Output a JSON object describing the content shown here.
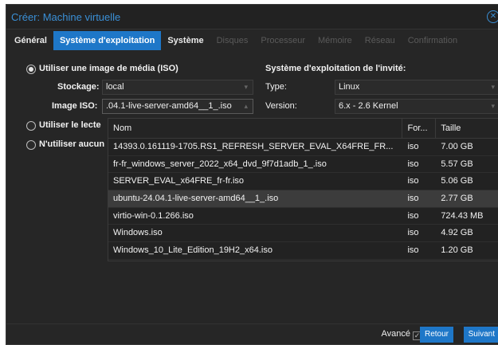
{
  "window": {
    "title": "Créer: Machine virtuelle",
    "close_icon": "close-icon"
  },
  "tabs": [
    {
      "label": "Général",
      "state": "normal"
    },
    {
      "label": "Système d'exploitation",
      "state": "active"
    },
    {
      "label": "Système",
      "state": "normal"
    },
    {
      "label": "Disques",
      "state": "disabled"
    },
    {
      "label": "Processeur",
      "state": "disabled"
    },
    {
      "label": "Mémoire",
      "state": "disabled"
    },
    {
      "label": "Réseau",
      "state": "disabled"
    },
    {
      "label": "Confirmation",
      "state": "disabled"
    }
  ],
  "media": {
    "use_iso_label": "Utiliser une image de média (ISO)",
    "storage_label": "Stockage:",
    "storage_value": "local",
    "iso_label": "Image ISO:",
    "iso_value": ".04.1-live-server-amd64__1_.iso",
    "use_drive_label": "Utiliser le lecte",
    "no_media_label": "N'utiliser aucun"
  },
  "guest_os": {
    "heading": "Système d'exploitation de l'invité:",
    "type_label": "Type:",
    "type_value": "Linux",
    "version_label": "Version:",
    "version_value": "6.x - 2.6 Kernel"
  },
  "iso_list": {
    "columns": {
      "name": "Nom",
      "format": "For...",
      "size": "Taille"
    },
    "rows": [
      {
        "name": "14393.0.161119-1705.RS1_REFRESH_SERVER_EVAL_X64FRE_FR...",
        "format": "iso",
        "size": "7.00 GB"
      },
      {
        "name": "fr-fr_windows_server_2022_x64_dvd_9f7d1adb_1_.iso",
        "format": "iso",
        "size": "5.57 GB"
      },
      {
        "name": "SERVER_EVAL_x64FRE_fr-fr.iso",
        "format": "iso",
        "size": "5.06 GB"
      },
      {
        "name": "ubuntu-24.04.1-live-server-amd64__1_.iso",
        "format": "iso",
        "size": "2.77 GB"
      },
      {
        "name": "virtio-win-0.1.266.iso",
        "format": "iso",
        "size": "724.43 MB"
      },
      {
        "name": "Windows.iso",
        "format": "iso",
        "size": "4.92 GB"
      },
      {
        "name": "Windows_10_Lite_Edition_19H2_x64.iso",
        "format": "iso",
        "size": "1.20 GB"
      }
    ],
    "selected_index": 3
  },
  "footer": {
    "advanced_label": "Avancé",
    "advanced_checked": true,
    "back_label": "Retour",
    "next_label": "Suivant"
  },
  "colors": {
    "accent": "#1e77c8",
    "title": "#3a8fd6",
    "background": "#262626"
  }
}
